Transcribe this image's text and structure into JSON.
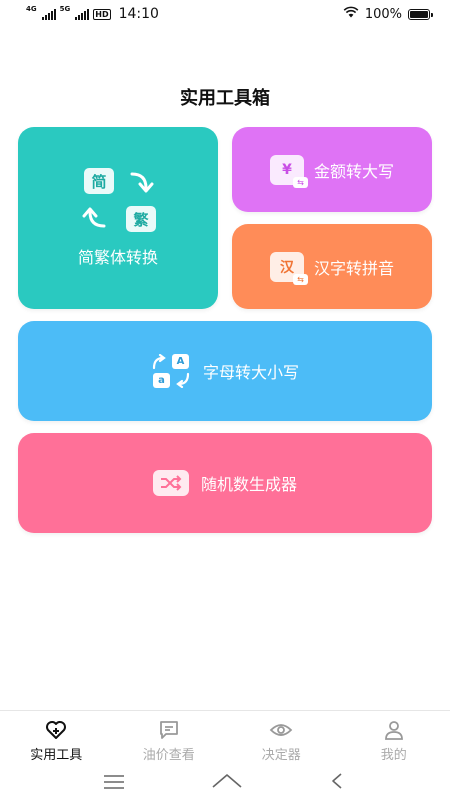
{
  "status_bar": {
    "net1": "4G",
    "net2": "5G",
    "hd": "HD",
    "time": "14:10",
    "battery": "100%",
    "battery_level": 1.0
  },
  "page": {
    "title": "实用工具箱"
  },
  "cards": {
    "jianfan": {
      "label": "简繁体转换",
      "glyph_a": "简",
      "glyph_b": "繁",
      "color": "#2ac9c0"
    },
    "jine": {
      "label": "金额转大写",
      "glyph": "¥",
      "color": "#df73f5"
    },
    "hanzi": {
      "label": "汉字转拼音",
      "glyph": "汉",
      "color": "#ff8c58"
    },
    "zimu": {
      "label": "字母转大小写",
      "glyph_upper": "A",
      "glyph_lower": "a",
      "color": "#4cbcf7"
    },
    "suiji": {
      "label": "随机数生成器",
      "color": "#ff7098"
    }
  },
  "tabbar": {
    "tabs": [
      {
        "label": "实用工具",
        "icon": "heart-plus-icon",
        "active": true
      },
      {
        "label": "油价查看",
        "icon": "message-icon",
        "active": false
      },
      {
        "label": "决定器",
        "icon": "eye-icon",
        "active": false
      },
      {
        "label": "我的",
        "icon": "user-icon",
        "active": false
      }
    ]
  },
  "navbar": {
    "buttons": [
      "menu-icon",
      "home-icon",
      "back-icon"
    ]
  }
}
